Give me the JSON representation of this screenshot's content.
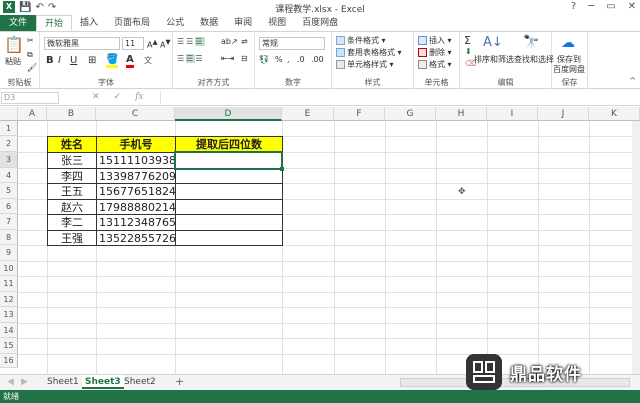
{
  "titlebar": {
    "title": "课程教学.xlsx - Excel",
    "help": "?",
    "minimize": "─",
    "restore": "▭",
    "close": "✕"
  },
  "tabs": [
    "文件",
    "开始",
    "插入",
    "页面布局",
    "公式",
    "数据",
    "审阅",
    "视图",
    "百度网盘"
  ],
  "ribbon": {
    "paste": "粘贴",
    "clipboard": "剪贴板",
    "font_name": "微软雅黑",
    "font_size": "11",
    "font_group": "字体",
    "bold": "B",
    "italic": "I",
    "underline": "U",
    "align_group": "对齐方式",
    "number_format": "常规",
    "number_group": "数字",
    "cond_format": "条件格式",
    "table_format": "套用表格格式",
    "cell_style": "单元格样式",
    "style_group": "样式",
    "insert": "插入",
    "delete": "删除",
    "format": "格式",
    "cells_group": "单元格",
    "sum": "Σ",
    "sort_filter": "排序和筛选",
    "find_select": "查找和选择",
    "edit_group": "编辑",
    "save_baidu": "保存到",
    "save_baidu2": "百度网盘",
    "save_group": "保存"
  },
  "formula_bar": {
    "name_box": "D3",
    "cancel": "✕",
    "confirm": "✓",
    "fx": "fx",
    "content": ""
  },
  "columns": [
    "A",
    "B",
    "C",
    "D",
    "E",
    "F",
    "G",
    "H",
    "I",
    "J",
    "K"
  ],
  "rows": [
    "1",
    "2",
    "3",
    "4",
    "5",
    "6",
    "7",
    "8",
    "9",
    "10",
    "11",
    "12",
    "13",
    "14",
    "15",
    "16"
  ],
  "table": {
    "headers": [
      "姓名",
      "手机号",
      "提取后四位数"
    ],
    "rows": [
      [
        "张三",
        "15111103938",
        ""
      ],
      [
        "李四",
        "13398776209",
        ""
      ],
      [
        "王五",
        "15677651824",
        ""
      ],
      [
        "赵六",
        "17988880214",
        ""
      ],
      [
        "李二",
        "13112348765",
        ""
      ],
      [
        "王强",
        "13522855726",
        ""
      ]
    ]
  },
  "sheets": [
    "Sheet1",
    "Sheet3",
    "Sheet2"
  ],
  "add_sheet": "+",
  "status": "就绪",
  "watermark": "鼎品软件",
  "colors": {
    "accent": "#217346",
    "header_fill": "#ffff00"
  }
}
